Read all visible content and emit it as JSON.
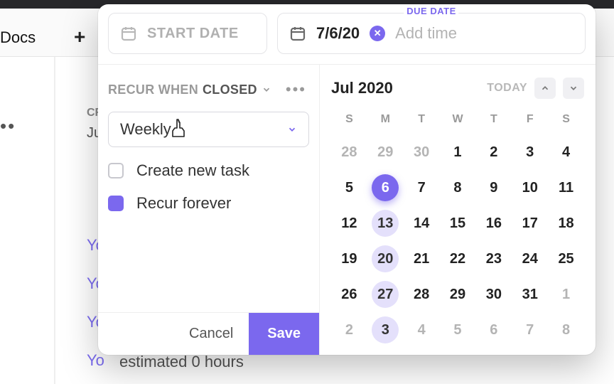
{
  "bg": {
    "docs": "Docs",
    "items": [
      "Yo",
      "Yo",
      "Yo",
      "Yo"
    ],
    "estimated": "estimated 0 hours"
  },
  "popover": {
    "start": {
      "placeholder": "START DATE"
    },
    "due": {
      "label": "DUE DATE",
      "value": "7/6/20",
      "add_time": "Add time"
    },
    "recur": {
      "title_prefix": "RECUR WHEN",
      "title_value": "CLOSED",
      "frequency": "Weekly",
      "create_new_label": "Create new task",
      "recur_forever_label": "Recur forever",
      "create_new_checked": false,
      "recur_forever_checked": true
    },
    "footer": {
      "cancel": "Cancel",
      "save": "Save"
    },
    "calendar": {
      "month_label": "Jul 2020",
      "today_label": "TODAY",
      "dow": [
        "S",
        "M",
        "T",
        "W",
        "T",
        "F",
        "S"
      ],
      "weeks": [
        [
          {
            "n": 28,
            "other": true
          },
          {
            "n": 29,
            "other": true
          },
          {
            "n": 30,
            "other": true
          },
          {
            "n": 1
          },
          {
            "n": 2
          },
          {
            "n": 3
          },
          {
            "n": 4
          }
        ],
        [
          {
            "n": 5
          },
          {
            "n": 6,
            "selected": true
          },
          {
            "n": 7
          },
          {
            "n": 8
          },
          {
            "n": 9
          },
          {
            "n": 10
          },
          {
            "n": 11
          }
        ],
        [
          {
            "n": 12
          },
          {
            "n": 13,
            "hl": true
          },
          {
            "n": 14
          },
          {
            "n": 15
          },
          {
            "n": 16
          },
          {
            "n": 17
          },
          {
            "n": 18
          }
        ],
        [
          {
            "n": 19
          },
          {
            "n": 20,
            "hl": true
          },
          {
            "n": 21
          },
          {
            "n": 22
          },
          {
            "n": 23
          },
          {
            "n": 24
          },
          {
            "n": 25
          }
        ],
        [
          {
            "n": 26
          },
          {
            "n": 27,
            "hl": true
          },
          {
            "n": 28
          },
          {
            "n": 29
          },
          {
            "n": 30
          },
          {
            "n": 31
          },
          {
            "n": 1,
            "other": true
          }
        ],
        [
          {
            "n": 2,
            "other": true
          },
          {
            "n": 3,
            "other": true,
            "hl": true
          },
          {
            "n": 4,
            "other": true
          },
          {
            "n": 5,
            "other": true
          },
          {
            "n": 6,
            "other": true
          },
          {
            "n": 7,
            "other": true
          },
          {
            "n": 8,
            "other": true
          }
        ]
      ]
    }
  }
}
